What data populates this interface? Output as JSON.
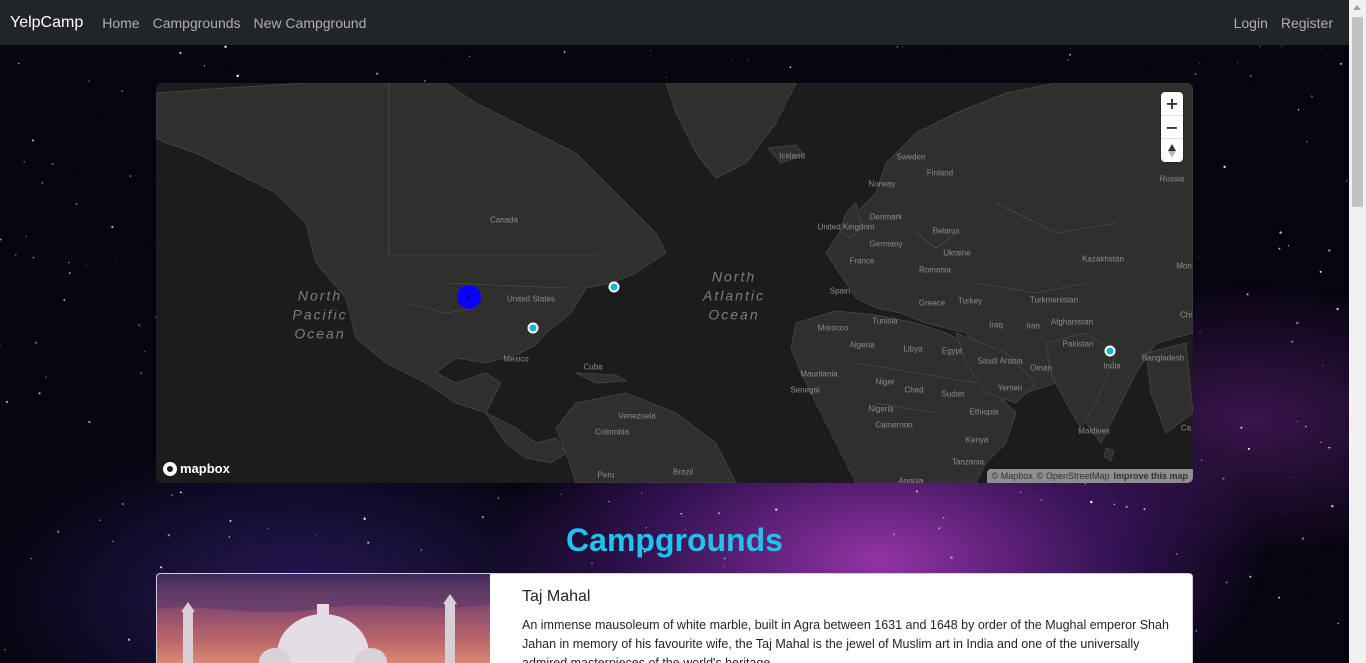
{
  "navbar": {
    "brand": "YelpCamp",
    "links": [
      "Home",
      "Campgrounds",
      "New Campground"
    ],
    "right_links": [
      "Login",
      "Register"
    ]
  },
  "map": {
    "country_labels": [
      "Iceland",
      "Sweden",
      "Finland",
      "Norway",
      "Russia",
      "Canada",
      "Denmark",
      "United Kingdom",
      "Belarus",
      "Germany",
      "France",
      "Ukraine",
      "Romania",
      "Kazakhstan",
      "Mon",
      "Spain",
      "Greece",
      "Turkey",
      "Turkmenistan",
      "Morocco",
      "Tunisia",
      "Iraq",
      "Iran",
      "Afghanistan",
      "Chi",
      "United States",
      "Mexico",
      "Cuba",
      "Algeria",
      "Libya",
      "Egypt",
      "Pakistan",
      "Saudi Arabia",
      "Oman",
      "India",
      "Bangladesh",
      "Mauritania",
      "Niger",
      "Chad",
      "Sudan",
      "Yemen",
      "Senegal",
      "Nigeria",
      "Ethiopia",
      "Venezuela",
      "Cameroon",
      "Colombia",
      "Kenya",
      "Maldives",
      "Peru",
      "Brazil",
      "Tanzania",
      "Ca",
      "Angola"
    ],
    "ocean_labels": [
      "North\nPacific\nOcean",
      "North\nAtlantic\nOcean"
    ],
    "zoom_in": "+",
    "zoom_out": "−",
    "logo_text": "mapbox",
    "attribution": [
      "© Mapbox",
      "© OpenStreetMap",
      "Improve this map"
    ],
    "marker_color": "#11b4da",
    "cluster_color": "#0a00ff"
  },
  "heading": "Campgrounds",
  "card": {
    "title": "Taj Mahal",
    "text": "An immense mausoleum of white marble, built in Agra between 1631 and 1648 by order of the Mughal emperor Shah Jahan in memory of his favourite wife, the Taj Mahal is the jewel of Muslim art in India and one of the universally admired masterpieces of the world's heritage."
  },
  "colors": {
    "navbar_bg": "#212529",
    "heading": "#1fc4ee",
    "map_bg": "#1b1c1c"
  }
}
